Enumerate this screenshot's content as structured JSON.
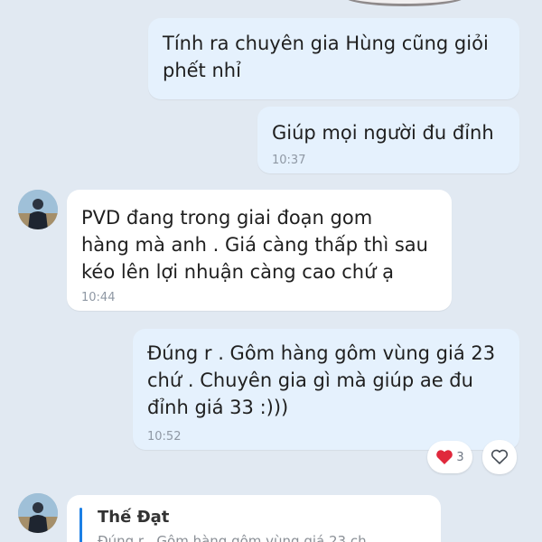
{
  "messages": [
    {
      "text": "Tính ra chuyên gia Hùng cũng giỏi\nphết nhỉ",
      "time": ""
    },
    {
      "text": "Giúp mọi người đu đỉnh",
      "time": "10:37"
    },
    {
      "text": "PVD đang trong giai đoạn gom\nhàng mà anh . Giá càng thấp thì sau\nkéo lên lợi nhuận càng cao chứ ạ",
      "time": "10:44"
    },
    {
      "text": "Đúng r . Gôm hàng gôm vùng giá 23\nchứ . Chuyên gia gì mà giúp ae đu\nđỉnh giá 33 :)))",
      "time": "10:52"
    }
  ],
  "reactions": {
    "heart_count": "3",
    "heart_icon": "red-heart-icon",
    "add_icon": "outline-heart-icon"
  },
  "reply": {
    "author": "Thế Đạt",
    "quoted": "Đúng r . Gôm hàng gôm vùng giá 23 ch"
  },
  "colors": {
    "background": "#e1e9f2",
    "sent_bubble": "#e5f1fd",
    "received_bubble": "#ffffff",
    "quote_bar": "#1c7fe5",
    "heart": "#e0283c"
  }
}
